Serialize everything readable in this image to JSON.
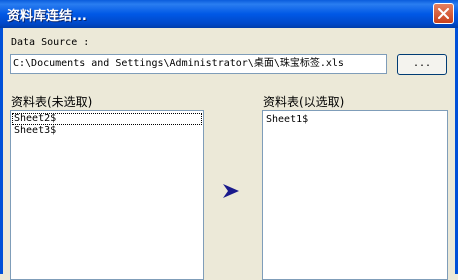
{
  "window": {
    "title": "资料库连结..."
  },
  "source": {
    "label": "Data Source :",
    "path": "C:\\Documents and Settings\\Administrator\\桌面\\珠宝标签.xls",
    "browse_label": "..."
  },
  "available": {
    "label": "资料表(未选取)",
    "items": [
      "Sheet2$",
      "Sheet3$"
    ]
  },
  "selected": {
    "label": "资料表(以选取)",
    "items": [
      "Sheet1$"
    ]
  },
  "colors": {
    "titlebar": "#0058e6",
    "arrow": "#1a1a8c",
    "close": "#c8401c"
  },
  "icons": {
    "close": "close-icon",
    "move": "arrow-right-icon"
  }
}
